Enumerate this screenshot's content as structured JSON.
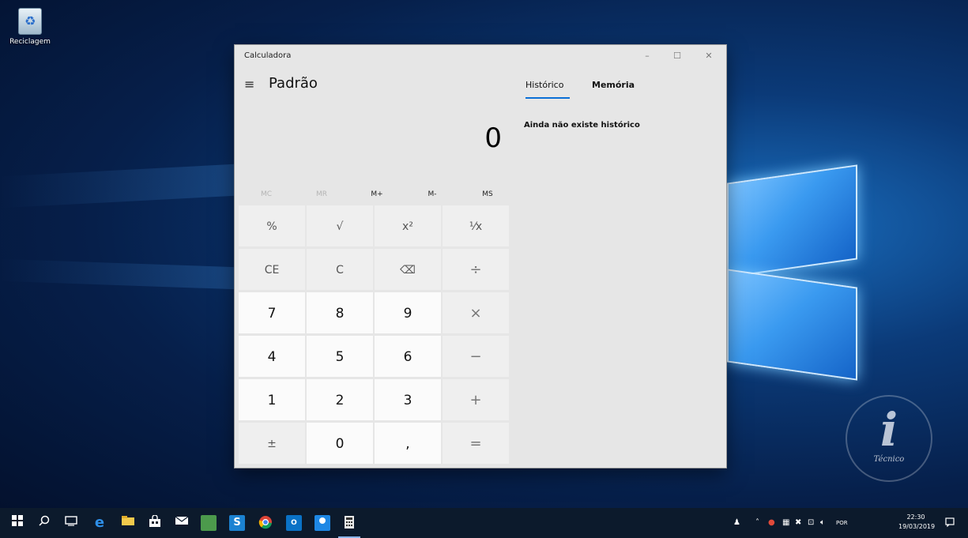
{
  "desktop": {
    "recycle_bin_label": "Reciclagem",
    "watermark_letter": "i",
    "watermark_text": "Técnico"
  },
  "calculator": {
    "window_title": "Calculadora",
    "window_controls": {
      "minimize": "–",
      "maximize": "☐",
      "close": "✕"
    },
    "menu_glyph": "≡",
    "mode": "Padrão",
    "display_value": "0",
    "memory_buttons": [
      "MC",
      "MR",
      "M+",
      "M-",
      "MS"
    ],
    "keys": [
      [
        "%",
        "√",
        "x²",
        "¹⁄x"
      ],
      [
        "CE",
        "C",
        "⌫",
        "÷"
      ],
      [
        "7",
        "8",
        "9",
        "×"
      ],
      [
        "4",
        "5",
        "6",
        "−"
      ],
      [
        "1",
        "2",
        "3",
        "+"
      ],
      [
        "±",
        "0",
        ",",
        "="
      ]
    ],
    "tabs": [
      "Histórico",
      "Memória"
    ],
    "history_empty": "Ainda não existe histórico"
  },
  "taskbar": {
    "language": "POR",
    "time": "22:30",
    "date": "19/03/2019"
  }
}
